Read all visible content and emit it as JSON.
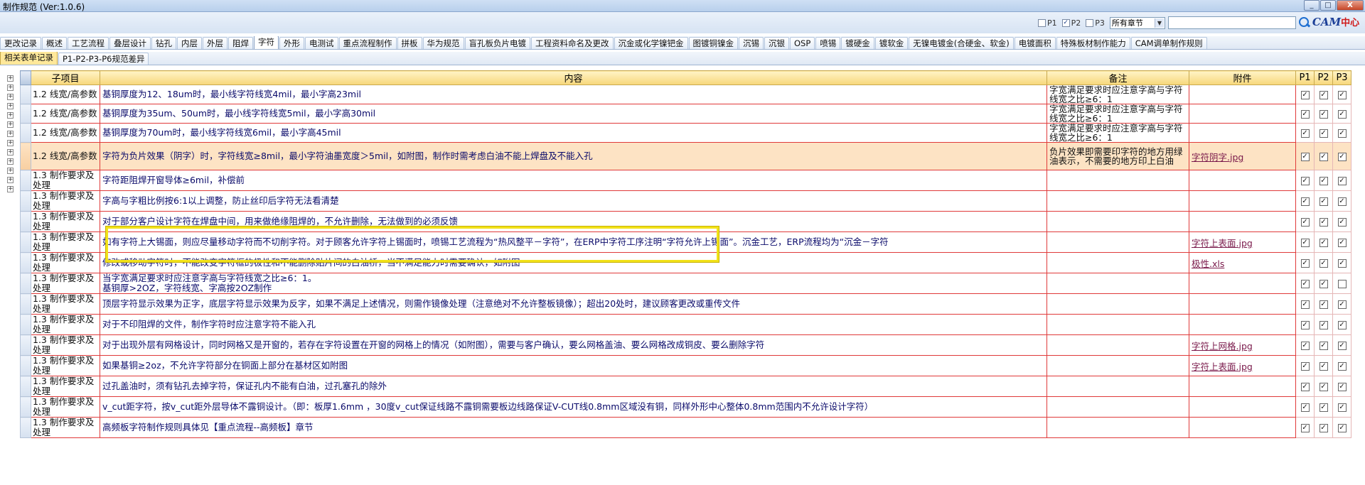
{
  "window": {
    "title": "制作规范 (Ver:1.0.6)",
    "buttons": [
      "_",
      "□",
      "X"
    ]
  },
  "filters": {
    "options": [
      {
        "label": "P1",
        "checked": false
      },
      {
        "label": "P2",
        "checked": true
      },
      {
        "label": "P3",
        "checked": false
      }
    ],
    "chapter": "所有章节",
    "search_value": "",
    "logo_cam": "CAM",
    "logo_zx": "中心"
  },
  "tabs": [
    "更改记录",
    "概述",
    "工艺流程",
    "叠层设计",
    "钻孔",
    "内层",
    "外层",
    "阻焊",
    "字符",
    "外形",
    "电测试",
    "重点流程制作",
    "拼板",
    "华为规范",
    "盲孔板负片电镀",
    "工程资料命名及更改",
    "沉金或化学镍钯金",
    "图镀铜镍金",
    "沉锡",
    "沉银",
    "OSP",
    "喷锡",
    "镀硬金",
    "镀软金",
    "无镍电镀金(合硬金、软金)",
    "电镀面积",
    "特殊板材制作能力",
    "CAM调单制作规则"
  ],
  "active_tab": "字符",
  "subtabs": [
    "相关表单记录",
    "P1-P2-P3-P6规范差异"
  ],
  "columns": {
    "sub": "子项目",
    "content": "内容",
    "note": "备注",
    "attach": "附件",
    "p1": "P1",
    "p2": "P2",
    "p3": "P3"
  },
  "rows": [
    {
      "sub": "1.2 线宽/高参数",
      "content": "基铜厚度为12、18um时，最小线字符线宽4mil，最小字高23mil",
      "note": "字宽满足要求时应注意字高与字符线宽之比≥6：1",
      "attach": "",
      "p1": true,
      "p2": true,
      "p3": true
    },
    {
      "sub": "1.2 线宽/高参数",
      "content": "基铜厚度为35um、50um时，最小线字符线宽5mil，最小字高30mil",
      "note": "字宽满足要求时应注意字高与字符线宽之比≥6：1",
      "attach": "",
      "p1": true,
      "p2": true,
      "p3": true
    },
    {
      "sub": "1.2 线宽/高参数",
      "content": "基铜厚度为70um时，最小线字符线宽6mil，最小字高45mil",
      "note": "字宽满足要求时应注意字高与字符线宽之比≥6：1",
      "attach": "",
      "p1": true,
      "p2": true,
      "p3": true
    },
    {
      "sub": "1.2 线宽/高参数",
      "content": "字符为负片效果（阴字）时，字符线宽≥8mil，最小字符油墨宽度＞5mil，如附图，制作时需考虑白油不能上焊盘及不能入孔",
      "note": "负片效果即需要印字符的地方用绿油表示，不需要的地方印上白油",
      "attach": "字符阴字.jpg",
      "p1": true,
      "p2": true,
      "p3": true
    },
    {
      "sub": "1.3 制作要求及处理",
      "content": "字符距阻焊开窗导体≥6mil，补偿前",
      "note": "",
      "attach": "",
      "p1": true,
      "p2": true,
      "p3": true
    },
    {
      "sub": "1.3 制作要求及处理",
      "content": "字高与字粗比例按6:1以上调整，防止丝印后字符无法看清楚",
      "note": "",
      "attach": "",
      "p1": true,
      "p2": true,
      "p3": true
    },
    {
      "sub": "1.3 制作要求及处理",
      "content": "对于部分客户设计字符在焊盘中间，用来做绝缘阻焊的，不允许删除，无法做到的必须反馈",
      "note": "",
      "attach": "",
      "p1": true,
      "p2": true,
      "p3": true
    },
    {
      "sub": "1.3 制作要求及处理",
      "content": "如有字符上大锡面，则应尽量移动字符而不切削字符。对于顾客允许字符上锡面时，喷锡工艺流程为“热风整平－字符”，在ERP中字符工序注明“字符允许上锡面”。沉金工艺，ERP流程均为“沉金－字符",
      "note": "",
      "attach": "字符上表面.jpg",
      "p1": true,
      "p2": true,
      "p3": true
    },
    {
      "sub": "1.3 制作要求及处理",
      "content": "修改或移动字符时，不能改变字符框的极性和不能删除贴片间的白油桥，当不满足能力时需要确认，如附图",
      "note": "",
      "attach": "极性.xls",
      "p1": true,
      "p2": true,
      "p3": true
    },
    {
      "sub": "1.3 制作要求及处理",
      "content": "当字宽满足要求时应注意字高与字符线宽之比≥6：1。\n基铜厚>2OZ，字符线宽、字高按2OZ制作",
      "note": "",
      "attach": "",
      "p1": true,
      "p2": true,
      "p3": false
    },
    {
      "sub": "1.3 制作要求及处理",
      "content": "顶层字符显示效果为正字，底层字符显示效果为反字，如果不满足上述情况，则需作镜像处理（注意绝对不允许整板镜像）；超出20处时，建议顾客更改或重传文件",
      "note": "",
      "attach": "",
      "p1": true,
      "p2": true,
      "p3": true
    },
    {
      "sub": "1.3 制作要求及处理",
      "content": "对于不印阻焊的文件，制作字符时应注意字符不能入孔",
      "note": "",
      "attach": "",
      "p1": true,
      "p2": true,
      "p3": true
    },
    {
      "sub": "1.3 制作要求及处理",
      "content": "对于出现外层有网格设计，同时网格又是开窗的，若存在字符设置在开窗的网格上的情况（如附图），需要与客户确认，要么网格盖油、要么网格改成铜皮、要么删除字符",
      "note": "",
      "attach": "字符上网格.jpg",
      "p1": true,
      "p2": true,
      "p3": true
    },
    {
      "sub": "1.3 制作要求及处理",
      "content": "如果基铜≥2oz，不允许字符部分在铜面上部分在基材区如附图",
      "note": "",
      "attach": "字符上表面.jpg",
      "p1": true,
      "p2": true,
      "p3": true
    },
    {
      "sub": "1.3 制作要求及处理",
      "content": "过孔盖油时，须有钻孔去掉字符，保证孔内不能有白油，过孔塞孔的除外",
      "note": "",
      "attach": "",
      "p1": true,
      "p2": true,
      "p3": true
    },
    {
      "sub": "1.3 制作要求及处理",
      "content": "v_cut距字符，按v_cut距外层导体不露铜设计。（即：板厚1.6mm ，30度v_cut保证线路不露铜需要板边线路保证V-CUT线0.8mm区域没有铜，同样外形中心整体0.8mm范围内不允许设计字符）",
      "note": "",
      "attach": "",
      "p1": true,
      "p2": true,
      "p3": true
    },
    {
      "sub": "1.3 制作要求及处理",
      "content": "高频板字符制作规则具体见【重点流程--高频板】章节",
      "note": "",
      "attach": "",
      "p1": true,
      "p2": true,
      "p3": true
    }
  ]
}
